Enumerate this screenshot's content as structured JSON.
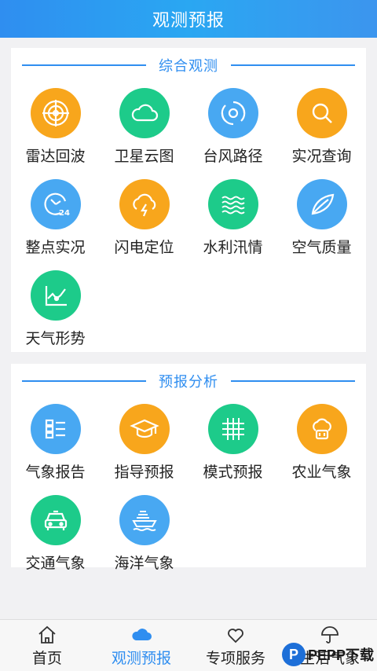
{
  "header": {
    "title": "观测预报"
  },
  "sections": [
    {
      "title": "综合观测",
      "items": [
        {
          "label": "雷达回波",
          "icon": "radar-icon",
          "color": "#f8a61c"
        },
        {
          "label": "卫星云图",
          "icon": "cloud-icon",
          "color": "#1dcb8a"
        },
        {
          "label": "台风路径",
          "icon": "typhoon-icon",
          "color": "#48a8f2"
        },
        {
          "label": "实况查询",
          "icon": "search-icon",
          "color": "#f8a61c"
        },
        {
          "label": "整点实况",
          "icon": "clock-24-icon",
          "color": "#48a8f2"
        },
        {
          "label": "闪电定位",
          "icon": "lightning-cloud-icon",
          "color": "#f8a61c"
        },
        {
          "label": "水利汛情",
          "icon": "water-waves-icon",
          "color": "#1dcb8a"
        },
        {
          "label": "空气质量",
          "icon": "leaf-icon",
          "color": "#48a8f2"
        },
        {
          "label": "天气形势",
          "icon": "trend-chart-icon",
          "color": "#1dcb8a"
        }
      ]
    },
    {
      "title": "预报分析",
      "items": [
        {
          "label": "气象报告",
          "icon": "report-list-icon",
          "color": "#48a8f2"
        },
        {
          "label": "指导预报",
          "icon": "graduation-cap-icon",
          "color": "#f8a61c"
        },
        {
          "label": "模式预报",
          "icon": "grid-icon",
          "color": "#1dcb8a"
        },
        {
          "label": "农业气象",
          "icon": "agriculture-icon",
          "color": "#f8a61c"
        },
        {
          "label": "交通气象",
          "icon": "car-icon",
          "color": "#1dcb8a"
        },
        {
          "label": "海洋气象",
          "icon": "ship-icon",
          "color": "#48a8f2"
        }
      ]
    }
  ],
  "tabbar": {
    "items": [
      {
        "label": "首页",
        "icon": "home-icon",
        "active": false
      },
      {
        "label": "观测预报",
        "icon": "cloud-icon",
        "active": true
      },
      {
        "label": "专项服务",
        "icon": "heart-icon",
        "active": false
      },
      {
        "label": "生活气象",
        "icon": "umbrella-icon",
        "active": false
      }
    ]
  },
  "watermark": {
    "text": "PEPP下载",
    "badge": "P"
  },
  "colors": {
    "accent": "#2f8ef0",
    "orange": "#f8a61c",
    "green": "#1dcb8a",
    "blue": "#48a8f2"
  }
}
